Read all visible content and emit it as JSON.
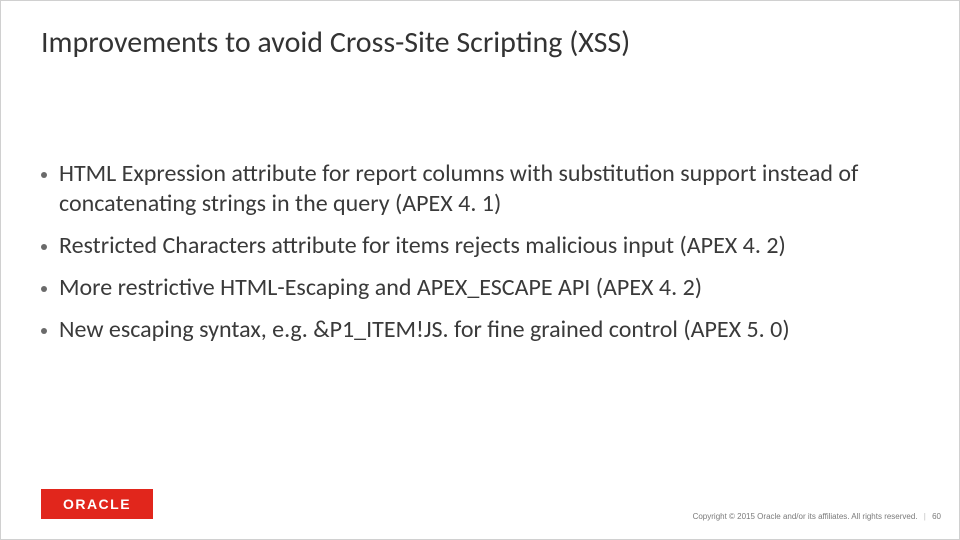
{
  "title": "Improvements to avoid Cross-Site Scripting (XSS)",
  "bullets": [
    "HTML Expression attribute for report columns with substitution support instead of concatenating strings in the query (APEX 4. 1)",
    "Restricted Characters attribute for items rejects malicious input (APEX 4. 2)",
    "More restrictive HTML-Escaping and APEX_ESCAPE API (APEX 4. 2)",
    "New escaping syntax, e.g. &P1_ITEM!JS. for fine grained control (APEX 5. 0)"
  ],
  "logo_text": "ORACLE",
  "footer": {
    "copyright": "Copyright © 2015 Oracle and/or its affiliates. All rights reserved.",
    "separator": "|",
    "page": "60"
  }
}
